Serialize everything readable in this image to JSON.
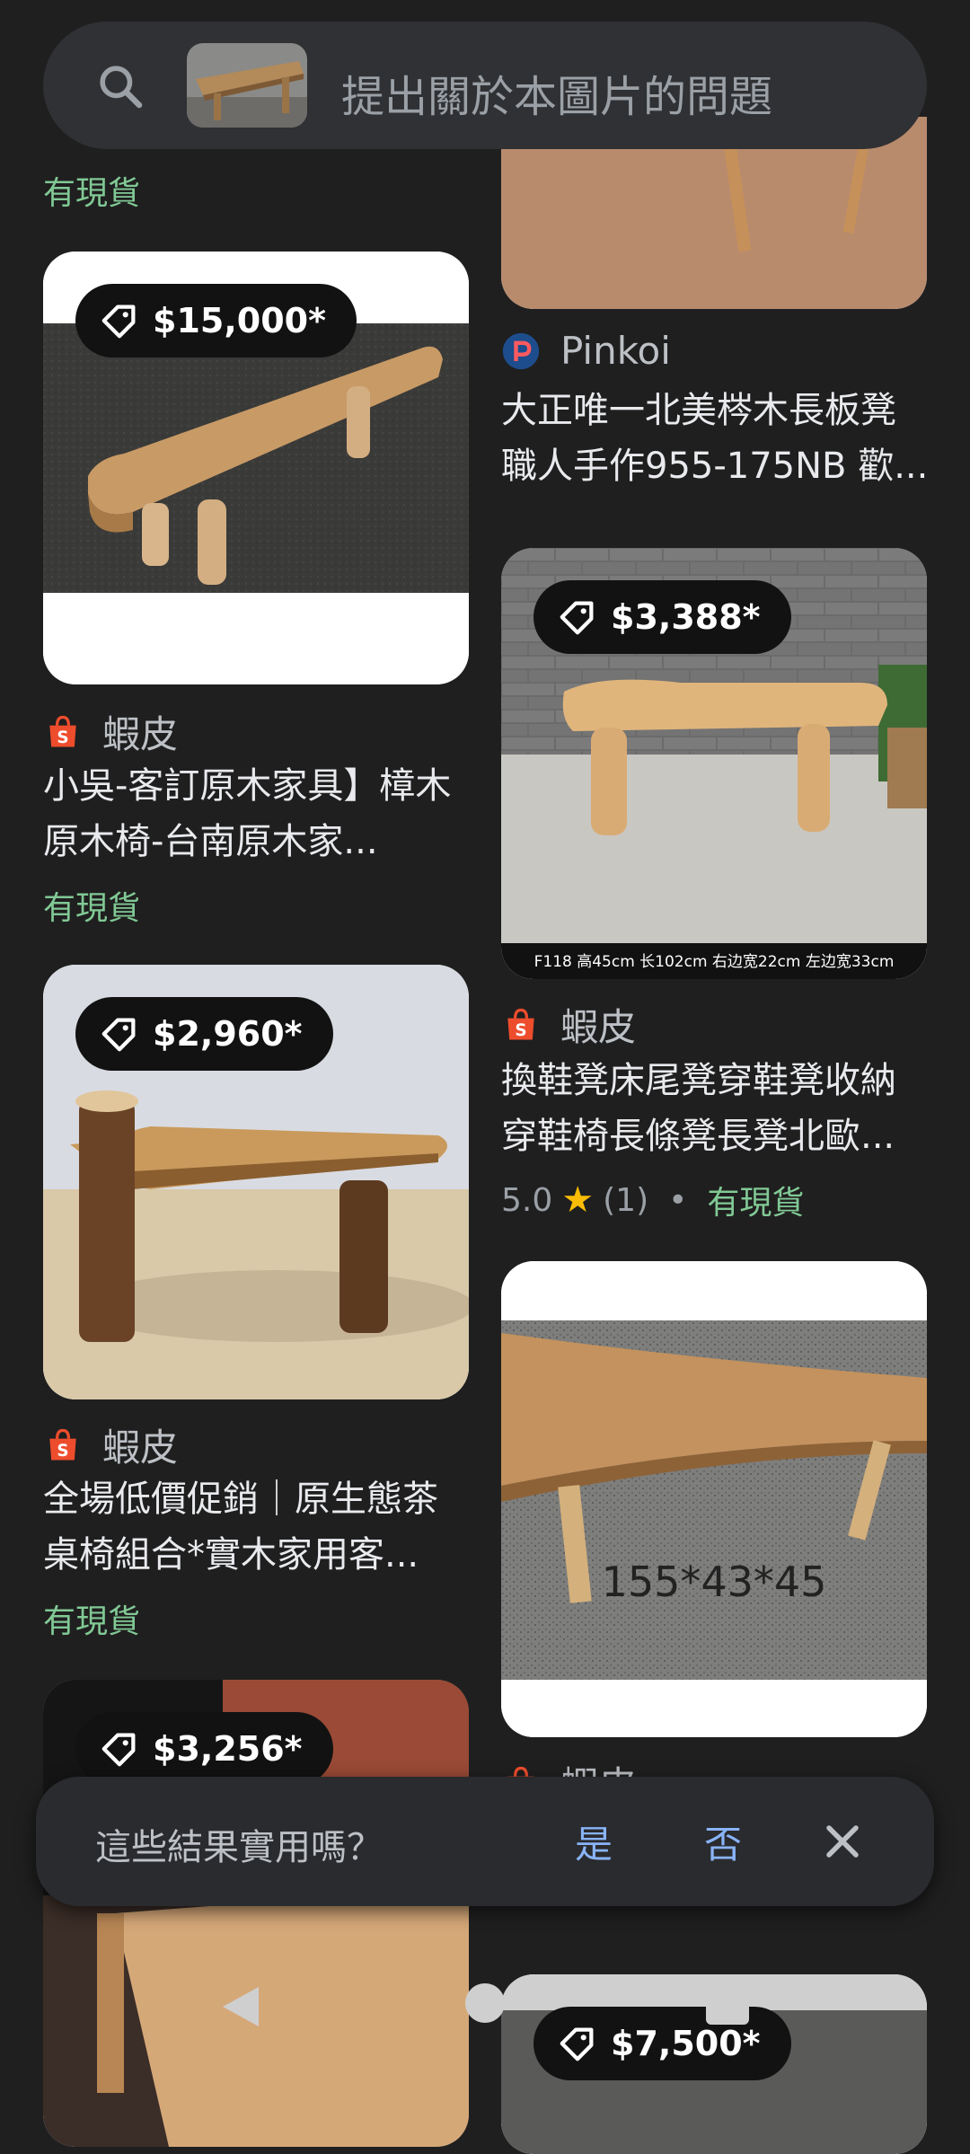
{
  "search": {
    "placeholder": "提出關於本圖片的問題"
  },
  "left_column": {
    "top_stock": "有現貨",
    "items": [
      {
        "price": "$15,000*",
        "source": "蝦皮",
        "title": "小吳-客訂原木家具】樟木原木椅-台南原木家...",
        "stock": "有現貨"
      },
      {
        "price": "$2,960*",
        "source": "蝦皮",
        "title": "全場低價促銷｜原生態茶桌椅組合*實木家用客...",
        "stock": "有現貨"
      },
      {
        "price": "$3,256*"
      }
    ]
  },
  "right_column": {
    "items": [
      {
        "source": "Pinkoi",
        "title": "大正唯一北美梣木長板凳 職人手作955-175NB 歡..."
      },
      {
        "price": "$3,388*",
        "image_caption": "F118  高45cm  长102cm  右边宽22cm  左边宽33cm",
        "source": "蝦皮",
        "title": "換鞋凳床尾凳穿鞋凳收納穿鞋椅長條凳長凳北歐...",
        "rating": "5.0",
        "reviews": "(1)",
        "separator": "•",
        "stock": "有現貨"
      },
      {
        "image_caption": "155*43*45",
        "source": "蝦皮"
      },
      {
        "price": "$7,500*"
      }
    ]
  },
  "feedback": {
    "question": "這些結果實用嗎？",
    "yes": "是",
    "no": "否"
  },
  "colors": {
    "background": "#1f1f1f",
    "stock_green": "#81c995",
    "link_blue": "#8ab4f8",
    "shopee_orange": "#ee4d2d",
    "star_yellow": "#fbbc04"
  }
}
